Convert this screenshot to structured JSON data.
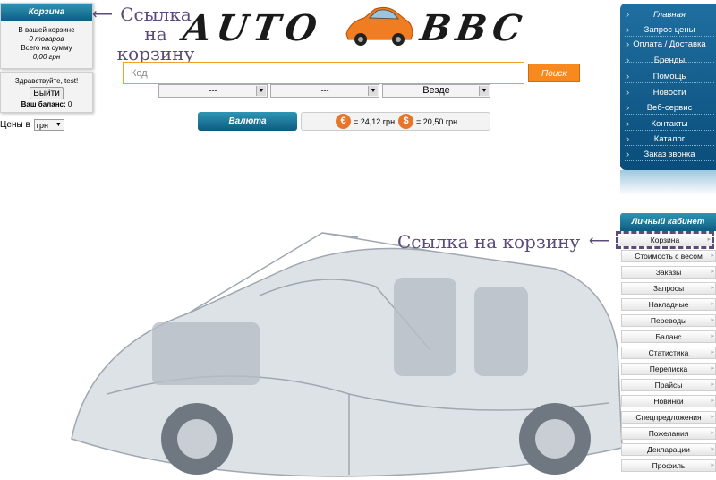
{
  "cart": {
    "title": "Корзина",
    "in_cart": "В вашей корзине",
    "items": "0 товаров",
    "total_label": "Всего на сумму",
    "total_value": "0,00 грн"
  },
  "login": {
    "greeting": "Здравствуйте, test!",
    "exit_label": "Выйти",
    "balance_label": "Ваш баланс:",
    "balance_value": "0"
  },
  "prices": {
    "label": "Цены в",
    "currency": "грн"
  },
  "annotations": {
    "left": "Ссылка на корзину",
    "right": "Ссылка на корзину"
  },
  "logo": {
    "left": "AUTO",
    "right": "BBC"
  },
  "search": {
    "placeholder": "Код",
    "button": "Поиск",
    "select1": "---",
    "select2": "---",
    "select3": "Везде"
  },
  "currency": {
    "button": "Валюта",
    "eur_symbol": "€",
    "eur_rate": "= 24,12 грн",
    "usd_symbol": "$",
    "usd_rate": "= 20,50 грн"
  },
  "nav": {
    "items": [
      "Главная",
      "Запрос цены",
      "Оплата / Доставка",
      "Бренды",
      "Помощь",
      "Новости",
      "Веб-сервис",
      "Контакты",
      "Каталог",
      "Заказ звонка"
    ]
  },
  "cabinet": {
    "title": "Личный кабинет",
    "items": [
      "Корзина",
      "Стоимость с весом",
      "Заказы",
      "Запросы",
      "Накладные",
      "Переводы",
      "Баланс",
      "Статистика",
      "Переписка",
      "Прайсы",
      "Новинки",
      "Спецпредложения",
      "Пожелания",
      "Декларации",
      "Профиль"
    ]
  },
  "colors": {
    "accent_blue": "#0d5c80",
    "accent_orange": "#f7891f",
    "annotation": "#5b4a7a"
  }
}
